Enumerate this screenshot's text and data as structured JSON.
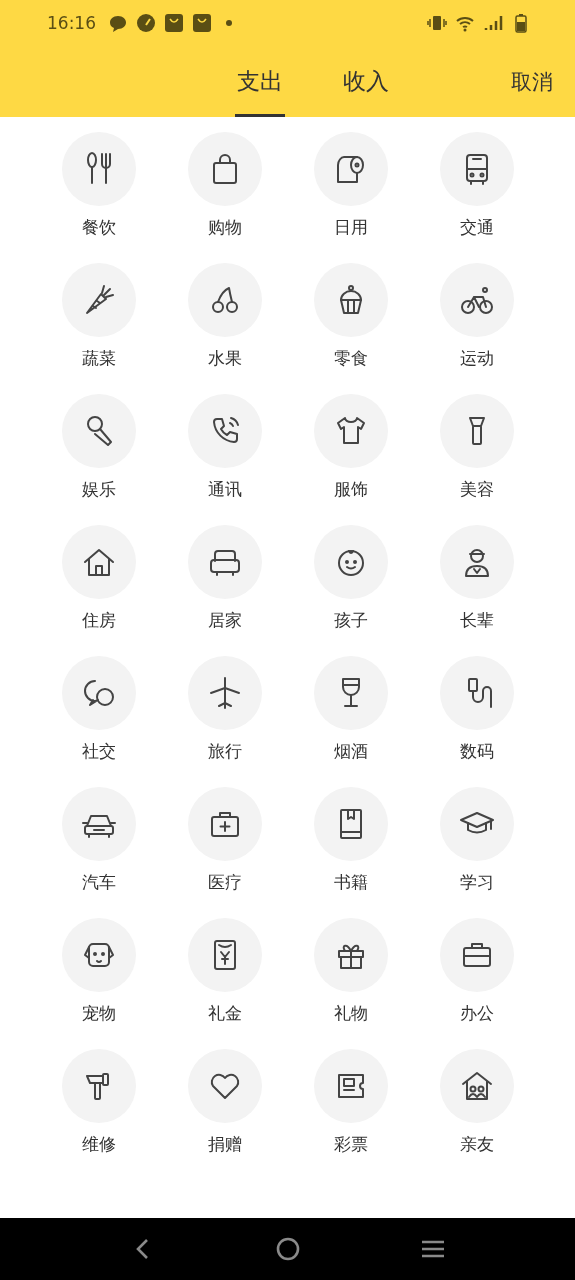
{
  "status_bar": {
    "time": "16:16"
  },
  "tabs": [
    {
      "label": "支出",
      "selected": true
    },
    {
      "label": "收入",
      "selected": false
    }
  ],
  "cancel": "取消",
  "categories": [
    {
      "label": "餐饮"
    },
    {
      "label": "购物"
    },
    {
      "label": "日用"
    },
    {
      "label": "交通"
    },
    {
      "label": "蔬菜"
    },
    {
      "label": "水果"
    },
    {
      "label": "零食"
    },
    {
      "label": "运动"
    },
    {
      "label": "娱乐"
    },
    {
      "label": "通讯"
    },
    {
      "label": "服饰"
    },
    {
      "label": "美容"
    },
    {
      "label": "住房"
    },
    {
      "label": "居家"
    },
    {
      "label": "孩子"
    },
    {
      "label": "长辈"
    },
    {
      "label": "社交"
    },
    {
      "label": "旅行"
    },
    {
      "label": "烟酒"
    },
    {
      "label": "数码"
    },
    {
      "label": "汽车"
    },
    {
      "label": "医疗"
    },
    {
      "label": "书籍"
    },
    {
      "label": "学习"
    },
    {
      "label": "宠物"
    },
    {
      "label": "礼金"
    },
    {
      "label": "礼物"
    },
    {
      "label": "办公"
    },
    {
      "label": "维修"
    },
    {
      "label": "捐赠"
    },
    {
      "label": "彩票"
    },
    {
      "label": "亲友"
    }
  ]
}
